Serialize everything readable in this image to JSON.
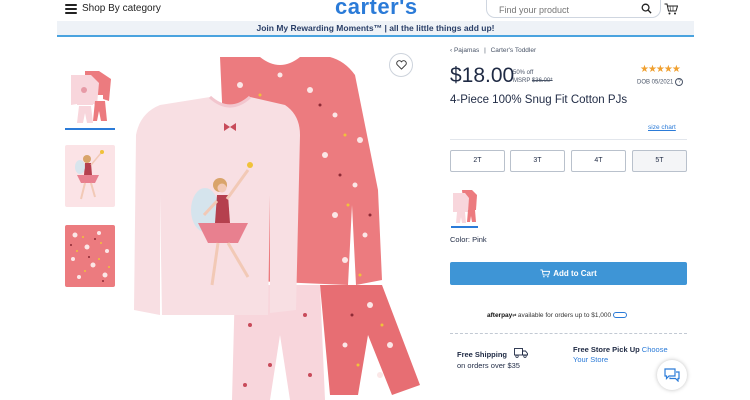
{
  "header": {
    "menu_label": "Shop By category",
    "logo": "carter's",
    "search_placeholder": "Find your product"
  },
  "banner": {
    "text": "Join My Rewarding Moments™  |  all the little things add up!"
  },
  "breadcrumb": [
    "‹ Pajamas",
    "|",
    "Carter's Toddler"
  ],
  "product": {
    "price": "$18.00",
    "discount": "50% off",
    "msrp_label": "MSRP",
    "msrp_value": "$36.00*",
    "rating_stars": "★★★★★",
    "dob": "DOB 05/2021",
    "title": "4-Piece 100% Snug Fit Cotton PJs",
    "size_chart": "size chart",
    "sizes": [
      "2T",
      "3T",
      "4T",
      "5T"
    ],
    "selected_size": "5T",
    "color_label": "Color: Pink",
    "add_to_cart": "Add to Cart"
  },
  "afterpay": {
    "brand": "afterpay",
    "text": "available for orders up to $1,000"
  },
  "shipping": {
    "title": "Free Shipping",
    "sub": "on orders over $35"
  },
  "store": {
    "title": "Free Store Pick Up",
    "link_1": "Choose",
    "link_2": "Your Store"
  },
  "colors": {
    "brand_blue": "#2b7bd8",
    "button_blue": "#3e95d6",
    "pink_light": "#fbe3e6",
    "coral": "#ec7b7f",
    "star": "#f0a030"
  }
}
